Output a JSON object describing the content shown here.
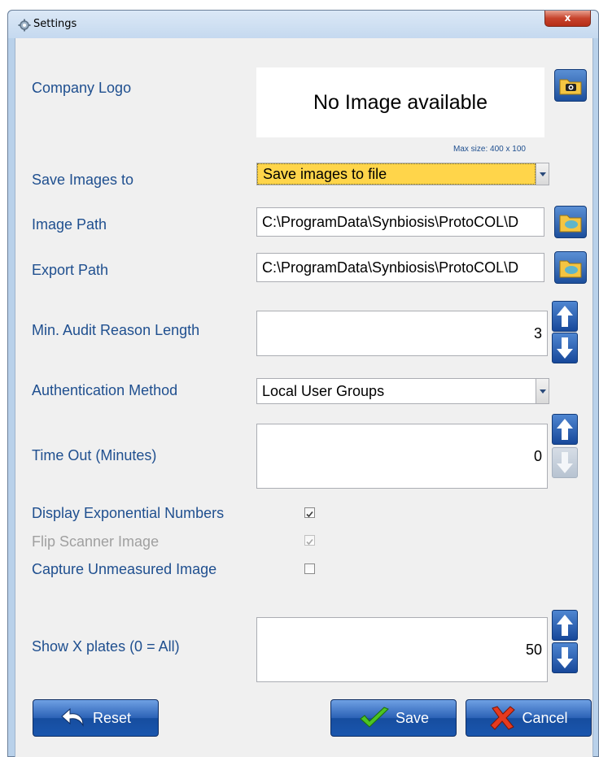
{
  "window": {
    "title": "Settings",
    "close_label": "x"
  },
  "company_logo": {
    "label": "Company Logo",
    "placeholder_text": "No Image available",
    "max_size": "Max size: 400 x 100"
  },
  "save_images": {
    "label": "Save Images to",
    "value": "Save images to file"
  },
  "image_path": {
    "label": "Image Path",
    "value": "C:\\ProgramData\\Synbiosis\\ProtoCOL\\D"
  },
  "export_path": {
    "label": "Export Path",
    "value": "C:\\ProgramData\\Synbiosis\\ProtoCOL\\D"
  },
  "audit_reason": {
    "label": "Min. Audit Reason Length",
    "value": "3"
  },
  "auth_method": {
    "label": "Authentication Method",
    "value": "Local User Groups"
  },
  "time_out": {
    "label": "Time Out (Minutes)",
    "value": "0"
  },
  "options": {
    "display_exponential": {
      "label": "Display Exponential Numbers",
      "checked": true
    },
    "flip_scanner": {
      "label": "Flip Scanner Image",
      "checked": true,
      "disabled": true
    },
    "capture_unmeasured": {
      "label": "Capture Unmeasured Image",
      "checked": false
    }
  },
  "show_plates": {
    "label": "Show X plates (0 = All)",
    "value": "50"
  },
  "buttons": {
    "reset": "Reset",
    "save": "Save",
    "cancel": "Cancel"
  },
  "colors": {
    "label_blue": "#1f4f8f",
    "highlight_yellow": "#ffd54a",
    "button_blue": "#1d4f9c"
  }
}
